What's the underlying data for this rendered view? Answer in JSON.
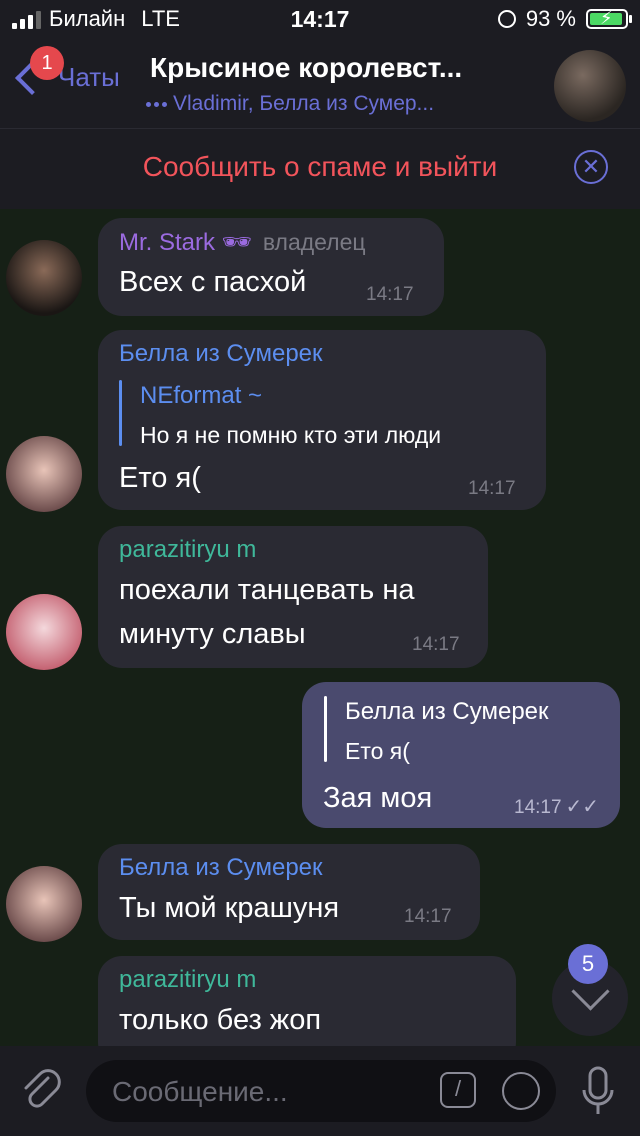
{
  "status_bar": {
    "carrier": "Билайн",
    "network": "LTE",
    "time": "14:17",
    "battery": "93 %",
    "battery_level": 0.93
  },
  "header": {
    "back_label": "Чаты",
    "unread_badge": "1",
    "title": "Крысиное королевст...",
    "subtitle": "Vladimir, Белла из Сумер..."
  },
  "spam_bar": {
    "label": "Сообщить о спаме и выйти"
  },
  "messages": [
    {
      "sender": "Mr. Stark 🕶",
      "role": "владелец",
      "text": "Всех с пасхой",
      "time": "14:17",
      "sender_color": "#9b6be0"
    },
    {
      "sender": "Белла из Сумерек",
      "reply_to_name": "NEformat ~",
      "reply_to_text": "Но я не помню кто эти люди",
      "text": "Ето я(",
      "time": "14:17",
      "sender_color": "#5c8ef0",
      "reply_color": "#5c8ef0"
    },
    {
      "sender": "parazitiryu m",
      "text_line1": "поехали танцевать на",
      "text_line2": "минуту славы",
      "time": "14:17",
      "sender_color": "#3fb89a"
    },
    {
      "outgoing": true,
      "reply_to_name": "Белла из Сумерек",
      "reply_to_text": "Ето я(",
      "text": "Зая моя",
      "time": "14:17"
    },
    {
      "sender": "Белла из Сумерек",
      "text": "Ты мой крашуня",
      "time": "14:17",
      "sender_color": "#5c8ef0"
    },
    {
      "sender": "parazitiryu m",
      "text": "только без жоп",
      "sender_color": "#3fb89a"
    }
  ],
  "scroll_down": {
    "badge": "5"
  },
  "input": {
    "placeholder": "Сообщение..."
  },
  "colors": {
    "accent": "#6a6fd6",
    "danger": "#f2545b",
    "background": "#162016"
  },
  "icons": {
    "back": "chevron-left-icon",
    "close": "close-circle-icon",
    "attach": "paperclip-icon",
    "commands": "slash-command-icon",
    "sticker": "sticker-icon",
    "mic": "microphone-icon",
    "scroll": "chevron-down-icon"
  }
}
